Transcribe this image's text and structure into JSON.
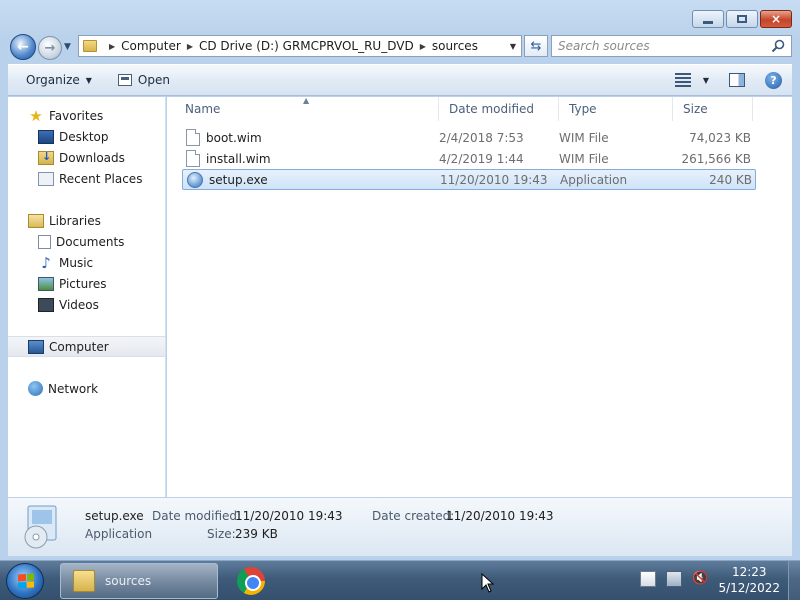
{
  "window": {
    "caption_close": "×"
  },
  "address": {
    "breadcrumbs": [
      "Computer",
      "CD Drive (D:) GRMCPRVOL_RU_DVD",
      "sources"
    ],
    "search_placeholder": "Search sources"
  },
  "commands": {
    "organize": "Organize",
    "open": "Open"
  },
  "nav": {
    "favorites": "Favorites",
    "favorites_items": [
      "Desktop",
      "Downloads",
      "Recent Places"
    ],
    "libraries": "Libraries",
    "libraries_items": [
      "Documents",
      "Music",
      "Pictures",
      "Videos"
    ],
    "computer": "Computer",
    "network": "Network"
  },
  "columns": {
    "name": "Name",
    "date": "Date modified",
    "type": "Type",
    "size": "Size"
  },
  "files": [
    {
      "name": "boot.wim",
      "date": "2/4/2018 7:53",
      "type": "WIM File",
      "size": "74,023 KB",
      "icon": "file-icon"
    },
    {
      "name": "install.wim",
      "date": "4/2/2019 1:44",
      "type": "WIM File",
      "size": "261,566 KB",
      "icon": "file-icon"
    },
    {
      "name": "setup.exe",
      "date": "11/20/2010 19:43",
      "type": "Application",
      "size": "240 KB",
      "icon": "setup-icon",
      "selected": true
    }
  ],
  "details": {
    "name": "setup.exe",
    "type": "Application",
    "date_modified_label": "Date modified:",
    "date_modified": "11/20/2010 19:43",
    "size_label": "Size:",
    "size": "239 KB",
    "date_created_label": "Date created:",
    "date_created": "11/20/2010 19:43"
  },
  "taskbar": {
    "task_label": "sources",
    "time": "12:23",
    "date": "5/12/2022"
  }
}
